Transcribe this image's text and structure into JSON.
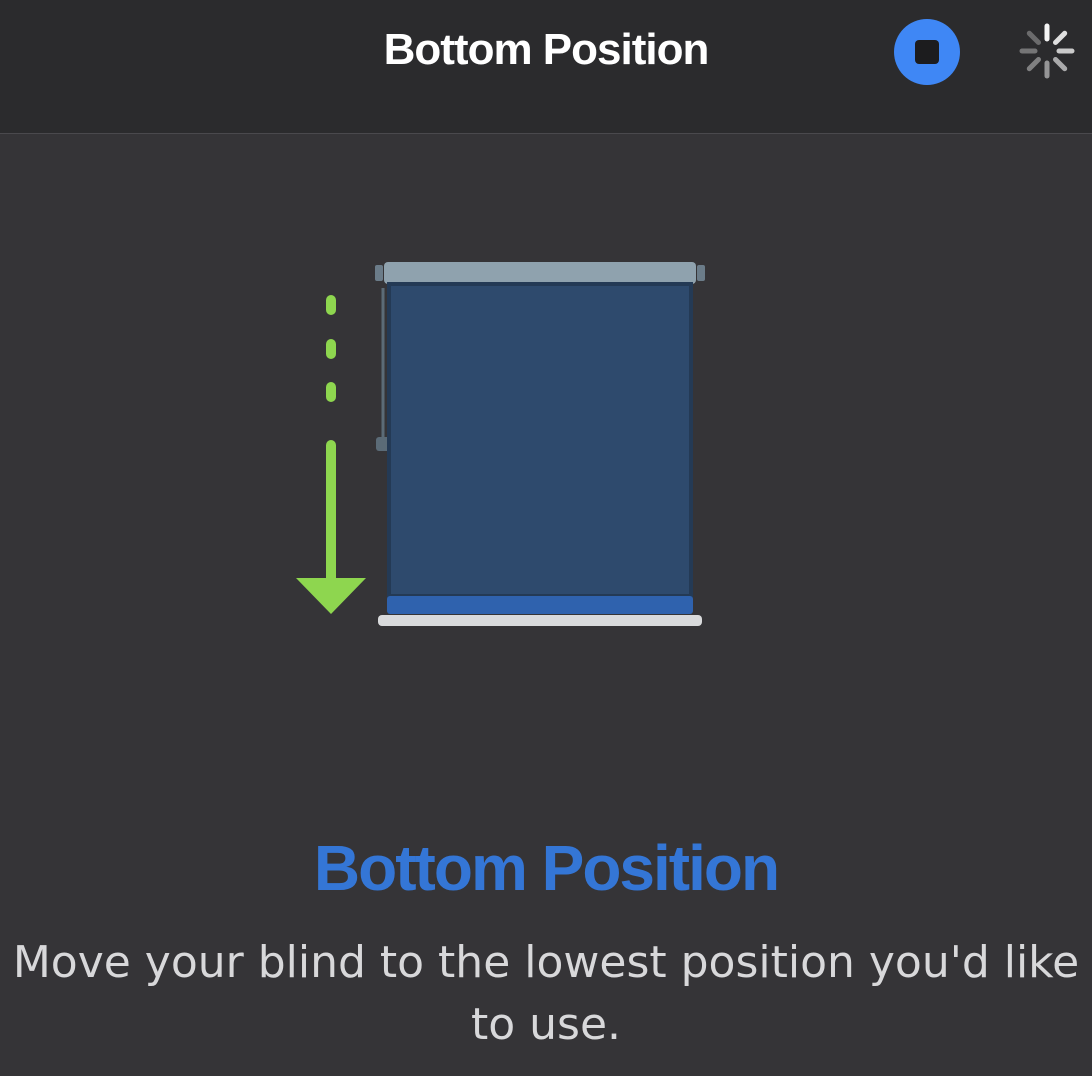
{
  "header": {
    "title": "Bottom Position",
    "stop_icon": "stop-icon",
    "activity_icon": "spinner-icon"
  },
  "content": {
    "title": "Bottom Position",
    "description": "Move your blind to the lowest position you'd like to use."
  },
  "colors": {
    "accent": "#3f87f5",
    "title_blue": "#3476d6",
    "arrow_green": "#8ed64f",
    "blind_fabric": "#2e4a6d"
  }
}
